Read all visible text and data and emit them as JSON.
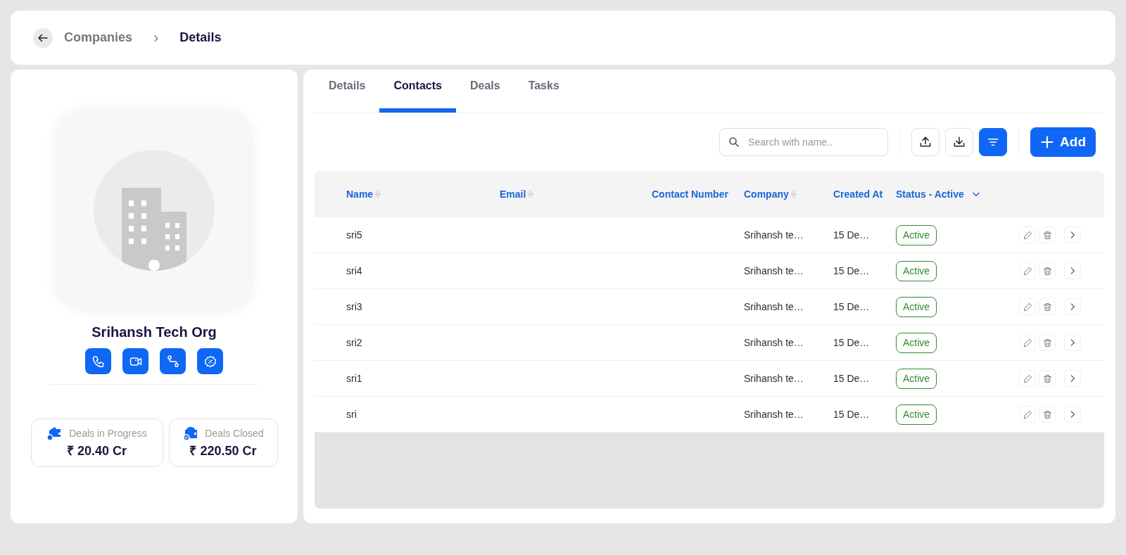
{
  "breadcrumb": {
    "parent": "Companies",
    "separator": "›",
    "current": "Details"
  },
  "company": {
    "name": "Srihansh Tech Org"
  },
  "stats": [
    {
      "kind": "progress",
      "label": "Deals in Progress",
      "value": "₹ 20.40 Cr"
    },
    {
      "kind": "closed",
      "label": "Deals Closed",
      "value": "₹ 220.50 Cr"
    }
  ],
  "tabs": [
    {
      "label": "Details",
      "selected": false
    },
    {
      "label": "Contacts",
      "selected": true
    },
    {
      "label": "Deals",
      "selected": false
    },
    {
      "label": "Tasks",
      "selected": false
    }
  ],
  "toolbar": {
    "search_placeholder": "Search with name..",
    "filter_on": true,
    "add_label": "Add"
  },
  "table": {
    "columns": [
      {
        "label": "Name",
        "sortable": true,
        "dropdown": false
      },
      {
        "label": "Email",
        "sortable": true,
        "dropdown": false
      },
      {
        "label": "Contact Number",
        "sortable": false,
        "dropdown": false
      },
      {
        "label": "Company",
        "sortable": true,
        "dropdown": false
      },
      {
        "label": "Created At",
        "sortable": false,
        "dropdown": false
      },
      {
        "label": "Status - Active",
        "sortable": false,
        "dropdown": true
      }
    ],
    "rows": [
      {
        "name": "sri5",
        "company": "Srihansh te…",
        "created_at": "15 De…",
        "status": "Active"
      },
      {
        "name": "sri4",
        "company": "Srihansh te…",
        "created_at": "15 De…",
        "status": "Active"
      },
      {
        "name": "sri3",
        "company": "Srihansh te…",
        "created_at": "15 De…",
        "status": "Active"
      },
      {
        "name": "sri2",
        "company": "Srihansh te…",
        "created_at": "15 De…",
        "status": "Active"
      },
      {
        "name": "sri1",
        "company": "Srihansh te…",
        "created_at": "15 De…",
        "status": "Active"
      },
      {
        "name": "sri",
        "company": "Srihansh te…",
        "created_at": "15 De…",
        "status": "Active"
      }
    ]
  }
}
